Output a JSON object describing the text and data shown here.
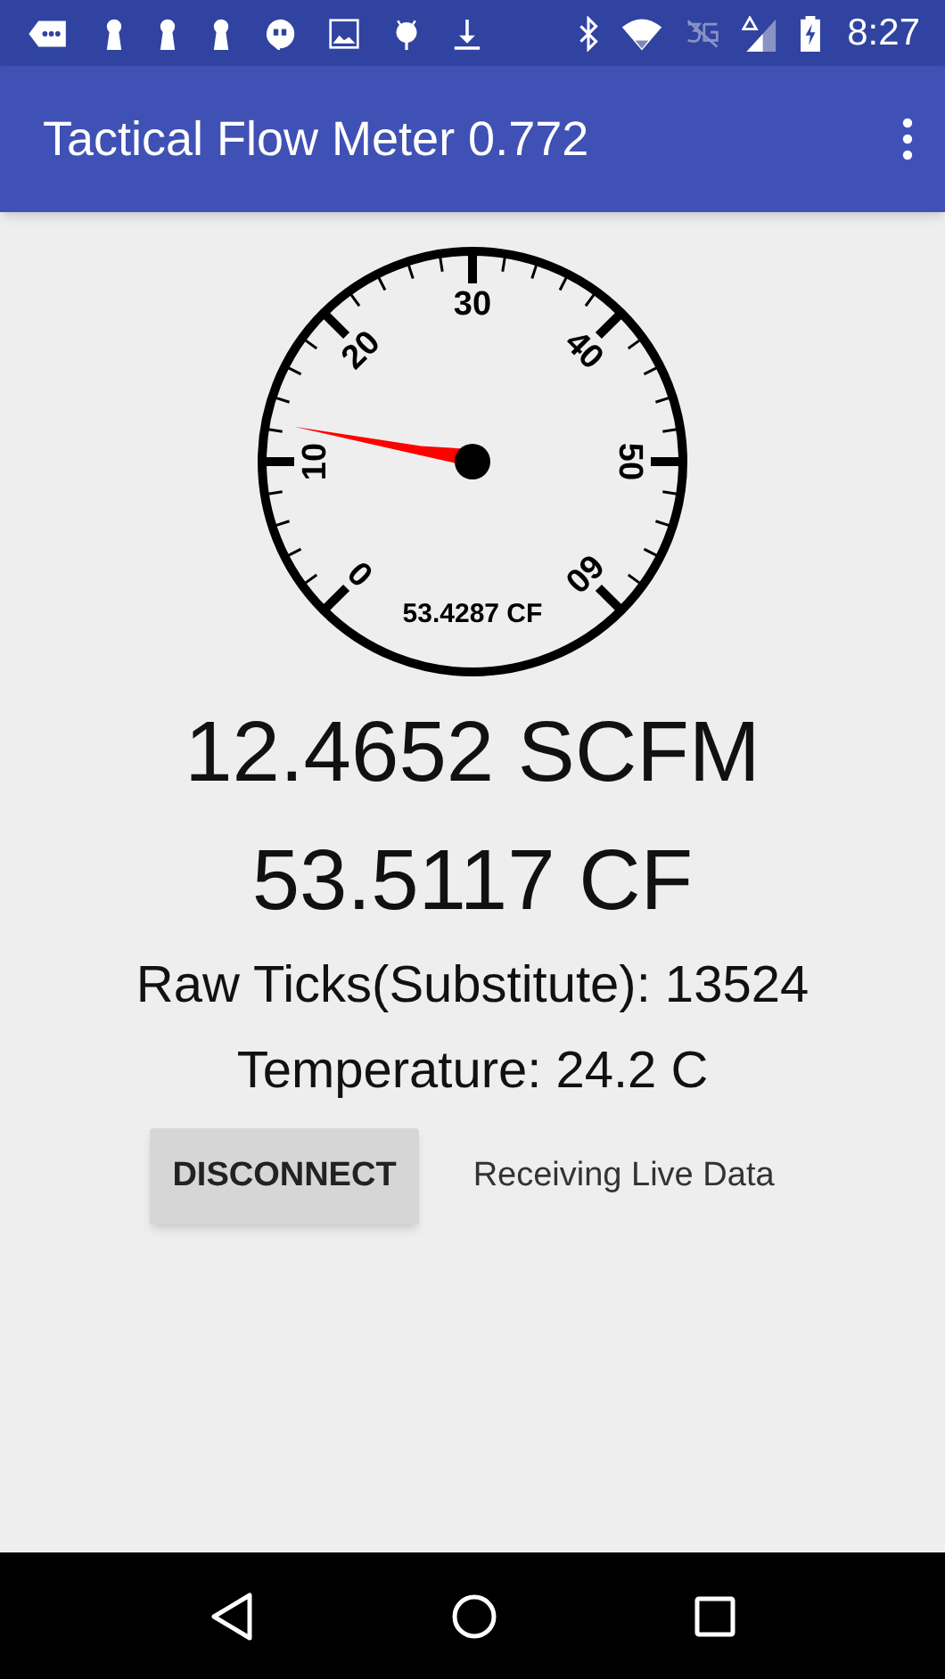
{
  "status_bar": {
    "time": "8:27"
  },
  "app_bar": {
    "title": "Tactical Flow Meter 0.772"
  },
  "gauge": {
    "scale_labels": [
      "0",
      "10",
      "20",
      "30",
      "40",
      "50",
      "60"
    ],
    "reading": "53.4287 CF"
  },
  "flow_rate": "12.4652 SCFM",
  "total_volume": "53.5117 CF",
  "raw_ticks": "Raw Ticks(Substitute): 13524",
  "temperature": "Temperature: 24.2 C",
  "disconnect_button": "DISCONNECT",
  "connection_status": "Receiving Live Data"
}
